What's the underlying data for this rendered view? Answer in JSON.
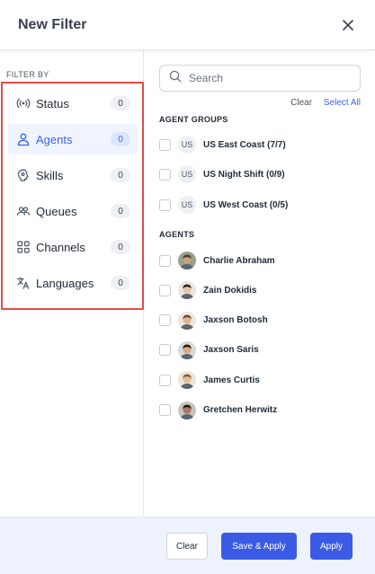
{
  "header": {
    "title": "New Filter"
  },
  "left": {
    "filter_by": "FILTER BY",
    "items": [
      {
        "label": "Status",
        "count": "0",
        "icon": "broadcast-icon",
        "active": false
      },
      {
        "label": "Agents",
        "count": "0",
        "icon": "user-icon",
        "active": true
      },
      {
        "label": "Skills",
        "count": "0",
        "icon": "brain-icon",
        "active": false
      },
      {
        "label": "Queues",
        "count": "0",
        "icon": "users-icon",
        "active": false
      },
      {
        "label": "Channels",
        "count": "0",
        "icon": "grid-icon",
        "active": false
      },
      {
        "label": "Languages",
        "count": "0",
        "icon": "translate-icon",
        "active": false
      }
    ]
  },
  "right": {
    "search": {
      "placeholder": "Search",
      "value": ""
    },
    "clear_link": "Clear",
    "select_all_link": "Select All",
    "groups_title": "AGENT GROUPS",
    "groups": [
      {
        "initials": "US",
        "label": "US East Coast (7/7)"
      },
      {
        "initials": "US",
        "label": "US Night Shift (0/9)"
      },
      {
        "initials": "US",
        "label": "US West Coast (0/5)"
      }
    ],
    "agents_title": "AGENTS",
    "agents": [
      {
        "name": "Charlie Abraham",
        "skin": "#c8a27f",
        "hair": "#4a3a2a",
        "bg": "#9aa089"
      },
      {
        "name": "Zain Dokidis",
        "skin": "#e8c4a4",
        "hair": "#2b2018",
        "bg": "#eae6e1"
      },
      {
        "name": "Jaxson Botosh",
        "skin": "#e0b493",
        "hair": "#6b4a2e",
        "bg": "#f0e6dc"
      },
      {
        "name": "Jaxson Saris",
        "skin": "#d9a987",
        "hair": "#1e1a17",
        "bg": "#d8d8d8"
      },
      {
        "name": "James Curtis",
        "skin": "#e6bd97",
        "hair": "#8a5a36",
        "bg": "#ede4da"
      },
      {
        "name": "Gretchen Herwitz",
        "skin": "#a97a5b",
        "hair": "#1c1512",
        "bg": "#c9c3bd"
      }
    ]
  },
  "footer": {
    "clear": "Clear",
    "save_apply": "Save & Apply",
    "apply": "Apply"
  },
  "colors": {
    "accent": "#3b5be6",
    "highlight": "#e34b4b",
    "active_bg": "#eff4ff"
  }
}
